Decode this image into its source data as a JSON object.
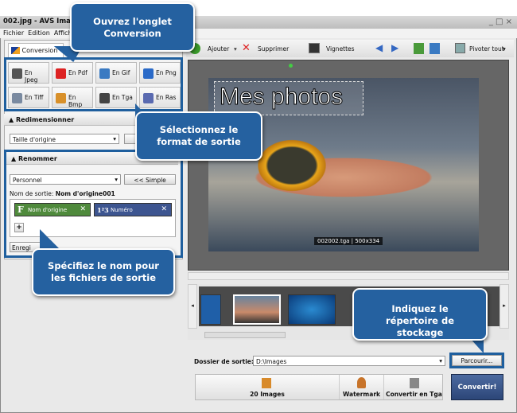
{
  "window": {
    "title": "002.jpg - AVS Imag",
    "controls": "_ □ ×"
  },
  "menu": [
    "Fichier",
    "Edition",
    "Affichage"
  ],
  "left": {
    "tab": "Conversion",
    "formats": [
      "En Jpeg",
      "En Pdf",
      "En Gif",
      "En Png",
      "En Tiff",
      "En Bmp",
      "En Tga",
      "En Ras"
    ],
    "resize": {
      "header": "Redimensionner",
      "select": "Taille d'origine"
    },
    "rename": {
      "header": "Renommer",
      "select": "Personnel",
      "simple_button": "<< Simple",
      "output_label": "Nom de sortie:",
      "output_value": "Nom d'origine001",
      "chips": [
        {
          "icon": "F",
          "label": "Nom d'origine"
        },
        {
          "icon": "1²3",
          "label": "Numéro"
        }
      ],
      "add": "+",
      "save": "Enregi"
    }
  },
  "toolbar": {
    "add": "Ajouter",
    "delete": "Supprimer",
    "thumbnails": "Vignettes",
    "rotate_all": "Pivoter tout"
  },
  "preview": {
    "overlay_text": "Mes photos",
    "info": "002002.tga | 500x334"
  },
  "bottom": {
    "folder_label": "Dossier de sortie:",
    "folder_value": "D:\\Images",
    "browse": "Parcourir...",
    "steps": [
      "20 Images",
      "Watermark",
      "Convertir en Tga"
    ],
    "convert": "Convertir!"
  },
  "callouts": [
    "Ouvrez l'onglet Conversion",
    "Sélectionnez le format de sortie",
    "Spécifiez le nom pour les fichiers de sortie",
    "Indiquez le répertoire de stockage"
  ],
  "colors": {
    "callout": "#2561a0",
    "accent": "#1f5f9e"
  }
}
